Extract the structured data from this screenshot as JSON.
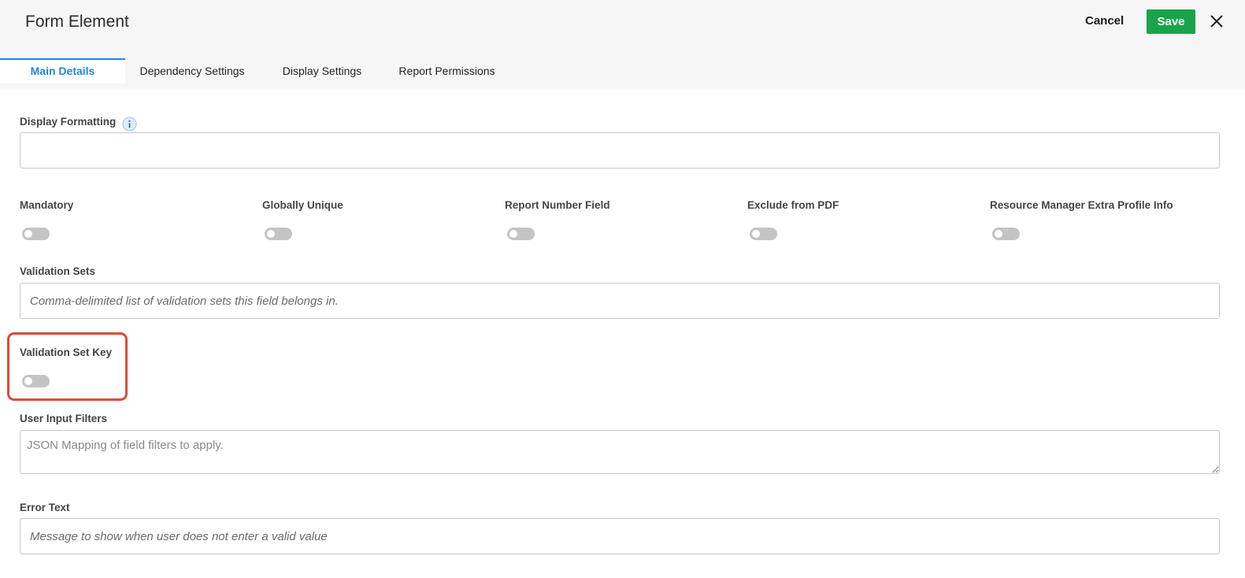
{
  "header": {
    "title": "Form Element",
    "cancel_label": "Cancel",
    "save_label": "Save"
  },
  "tabs": [
    {
      "label": "Main Details",
      "active": true
    },
    {
      "label": "Dependency Settings",
      "active": false
    },
    {
      "label": "Display Settings",
      "active": false
    },
    {
      "label": "Report Permissions",
      "active": false
    }
  ],
  "fields": {
    "display_formatting": {
      "label": "Display Formatting",
      "value": "",
      "placeholder": ""
    },
    "toggles": [
      {
        "label": "Mandatory",
        "on": false
      },
      {
        "label": "Globally Unique",
        "on": false
      },
      {
        "label": "Report Number Field",
        "on": false
      },
      {
        "label": "Exclude from PDF",
        "on": false
      },
      {
        "label": "Resource Manager Extra Profile Info",
        "on": false
      }
    ],
    "validation_sets": {
      "label": "Validation Sets",
      "value": "",
      "placeholder": "Comma-delimited list of validation sets this field belongs in."
    },
    "validation_set_key": {
      "label": "Validation Set Key",
      "on": false
    },
    "user_input_filters": {
      "label": "User Input Filters",
      "value": "",
      "placeholder": "JSON Mapping of field filters to apply."
    },
    "error_text": {
      "label": "Error Text",
      "value": "",
      "placeholder": "Message to show when user does not enter a valid value"
    }
  },
  "colors": {
    "accent": "#1f86e0",
    "save": "#1aa34a",
    "highlight": "#e04a35",
    "toggle_off": "#c4c4c4"
  },
  "icons": {
    "info": "info-icon",
    "close": "close-icon"
  }
}
